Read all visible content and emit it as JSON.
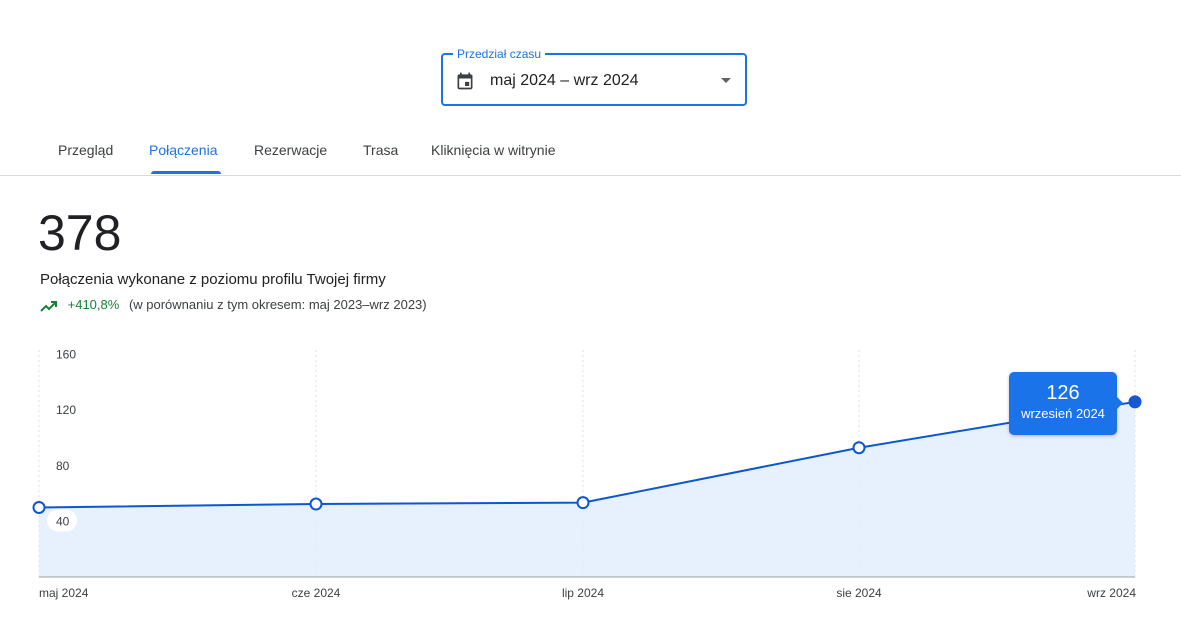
{
  "range_picker": {
    "label": "Przedział czasu",
    "value": "maj 2024 – wrz 2024"
  },
  "tabs": [
    {
      "label": "Przegląd",
      "active": false
    },
    {
      "label": "Połączenia",
      "active": true
    },
    {
      "label": "Rezerwacje",
      "active": false
    },
    {
      "label": "Trasa",
      "active": false
    },
    {
      "label": "Kliknięcia w witrynie",
      "active": false
    }
  ],
  "metric": {
    "value": "378",
    "description": "Połączenia wykonane z poziomu profilu Twojej firmy",
    "change": "+410,8%",
    "comparison": "(w porównaniu z tym okresem: maj 2023–wrz 2023)"
  },
  "tooltip": {
    "value": "126",
    "label": "wrzesień 2024"
  },
  "colors": {
    "accent": "#1a73e8",
    "line": "#0b57d0",
    "area": "#e3edfd",
    "positive": "#188038"
  },
  "chart_data": {
    "type": "area",
    "categories": [
      "maj 2024",
      "cze 2024",
      "lip 2024",
      "sie 2024",
      "wrz 2024"
    ],
    "x_tick_labels": [
      "maj 2024",
      "cze 2024",
      "lip 2024",
      "sie 2024",
      "wrz 2024"
    ],
    "series": [
      {
        "values": [
          50,
          52.5,
          53.5,
          93,
          126
        ]
      }
    ],
    "y_ticks": [
      40,
      80,
      120,
      160
    ],
    "ylim": [
      0,
      160
    ],
    "highlighted_index": 4,
    "grid": "vertical dotted",
    "legend": "none"
  }
}
